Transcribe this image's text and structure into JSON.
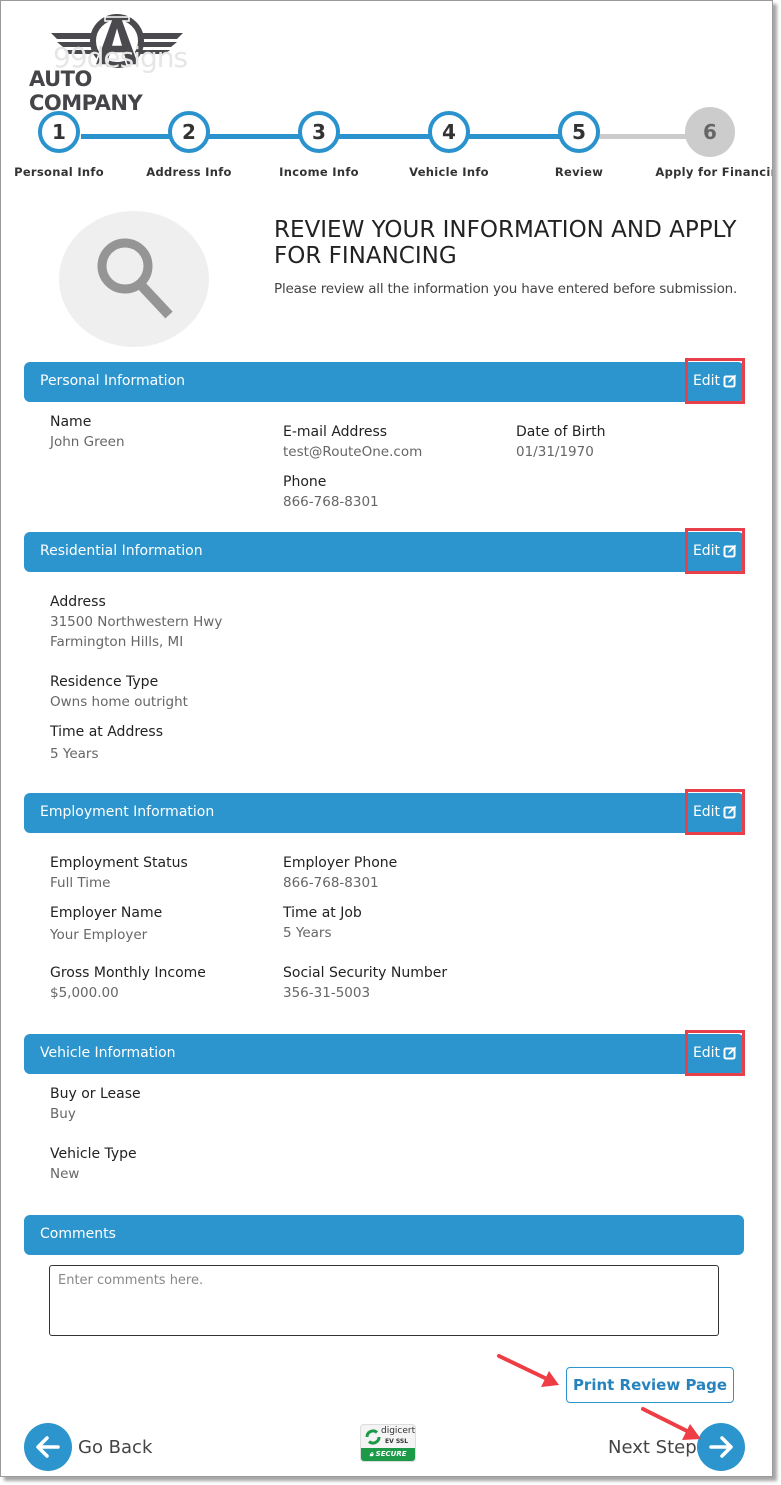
{
  "logo": {
    "brand_text": "AUTO COMPANY",
    "watermark_text": "99designs"
  },
  "stepper": {
    "steps": [
      {
        "number": "1",
        "label": "Personal Info",
        "state": "complete"
      },
      {
        "number": "2",
        "label": "Address Info",
        "state": "complete"
      },
      {
        "number": "3",
        "label": "Income Info",
        "state": "complete"
      },
      {
        "number": "4",
        "label": "Vehicle Info",
        "state": "complete"
      },
      {
        "number": "5",
        "label": "Review",
        "state": "current"
      },
      {
        "number": "6",
        "label": "Apply for Financir",
        "state": "inactive"
      }
    ]
  },
  "hero": {
    "icon": "search-icon",
    "title": "REVIEW YOUR INFORMATION AND APPLY FOR FINANCING",
    "subtitle": "Please review all the information you have entered before submission."
  },
  "sections": {
    "personal": {
      "title": "Personal Information",
      "edit_label": "Edit",
      "fields": [
        {
          "label": "Name",
          "value": "John Green"
        },
        {
          "label": "E-mail Address",
          "value": "test@RouteOne.com"
        },
        {
          "label": "Date of Birth",
          "value": "01/31/1970"
        },
        {
          "label": "Phone",
          "value": "866-768-8301"
        }
      ]
    },
    "residential": {
      "title": "Residential Information",
      "edit_label": "Edit",
      "fields": [
        {
          "label": "Address",
          "value": "31500 Northwestern Hwy",
          "value2": "Farmington Hills, MI"
        },
        {
          "label": "Residence Type",
          "value": "Owns home outright"
        },
        {
          "label": "Time at Address",
          "value": "5 Years"
        }
      ]
    },
    "employment": {
      "title": "Employment Information",
      "edit_label": "Edit",
      "fields": [
        {
          "label": "Employment Status",
          "value": "Full Time"
        },
        {
          "label": "Employer Phone",
          "value": "866-768-8301"
        },
        {
          "label": "Employer Name",
          "value": "Your Employer"
        },
        {
          "label": "Time at Job",
          "value": "5 Years"
        },
        {
          "label": "Gross Monthly Income",
          "value": "$5,000.00"
        },
        {
          "label": "Social Security Number",
          "value": "356-31-5003"
        }
      ]
    },
    "vehicle": {
      "title": "Vehicle Information",
      "edit_label": "Edit",
      "fields": [
        {
          "label": "Buy or Lease",
          "value": "Buy"
        },
        {
          "label": "Vehicle Type",
          "value": "New"
        }
      ]
    },
    "comments": {
      "title": "Comments",
      "placeholder": "Enter comments here.",
      "value": ""
    }
  },
  "actions": {
    "print_label": "Print Review Page",
    "go_back_label": "Go Back",
    "next_step_label": "Next Step"
  },
  "security_badge": {
    "brand": "digicert",
    "line2": "EV SSL",
    "line3": "SECURE"
  },
  "colors": {
    "accent": "#2d95ce",
    "highlight": "#e8404a",
    "inactive_step": "#cccccc"
  }
}
